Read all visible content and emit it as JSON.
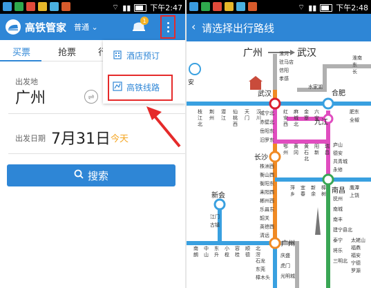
{
  "left": {
    "status": {
      "time": "下午2:47",
      "battery": "37"
    },
    "app": {
      "title": "高铁管家",
      "mode": "普通",
      "badge": "1"
    },
    "tabs": [
      "买票",
      "抢票",
      "行"
    ],
    "form": {
      "from_label": "出发地",
      "from_city": "广州",
      "date_label": "出发日期",
      "date": "7月31日",
      "today": "今天"
    },
    "search_label": "搜索",
    "menu": {
      "hotel": "酒店预订",
      "route": "高铁线路"
    }
  },
  "right": {
    "status": {
      "time": "下午2:48",
      "battery": "37"
    },
    "header": {
      "back": "‹",
      "title": "请选择出行路线"
    },
    "route": {
      "from": "广州",
      "to": "武汉"
    },
    "colors": {
      "orange": "#f08a24",
      "magenta": "#e04dbf",
      "blue": "#39a0e0",
      "green": "#3aa655",
      "gray": "#a0a0a0",
      "red": "#d9202f"
    },
    "stations": {
      "wuhan": "武汉",
      "hefei": "合肥",
      "jiujiang": "九江",
      "changsha": "长沙",
      "nanchang": "南昌",
      "xinhui": "新会",
      "guangzhou": "广州",
      "an": "安"
    },
    "north_stack": [
      "漯河",
      "驻马店",
      "信阳",
      "孝感"
    ],
    "shuijiahu": "水家湖",
    "right_stack_1": [
      "淮南",
      "东",
      "长"
    ],
    "row1": [
      "枝江北",
      "荆州",
      "潜江",
      "仙桃西",
      "天门",
      "汉川"
    ],
    "south_stack_1": [
      "咸宁北",
      "赤壁北",
      "岳阳东",
      "汨罗东"
    ],
    "row2": [
      "红安西",
      "麻城北",
      "金寨",
      "六安"
    ],
    "right_stack_2": [
      "肥东",
      "全椒"
    ],
    "row3": [
      "鄂州",
      "黄冈",
      "黄石北",
      "阳新",
      "瑞昌"
    ],
    "mid_stack": [
      "庐山",
      "德安",
      "共青城",
      "永修"
    ],
    "south_stack_2": [
      "株洲西",
      "衡山西",
      "衡阳东",
      "耒阳西",
      "郴州西",
      "乐昌东",
      "韶关",
      "英德西",
      "清远"
    ],
    "row4": [
      "萍乡",
      "宜春",
      "新余",
      "樟树"
    ],
    "right_stack_3": [
      "鹰潭",
      "上饶"
    ],
    "right_stack_4": [
      "抚州",
      "南城",
      "南丰",
      "建宁县北",
      "泰宁",
      "将乐",
      "三明北"
    ],
    "right_stack_5": [
      "太姥山",
      "福鼎",
      "福安",
      "宁德",
      "罗源"
    ],
    "xinhui_stack": [
      "江门",
      "古镇"
    ],
    "row5": [
      "南朗",
      "中山",
      "东升",
      "小榄",
      "容桂",
      "顺德",
      "北滘"
    ],
    "canton_stack": [
      "石龙",
      "东莞",
      "樟木头"
    ],
    "south_stack_3": [
      "庆盛",
      "虎门",
      "光明城"
    ]
  }
}
